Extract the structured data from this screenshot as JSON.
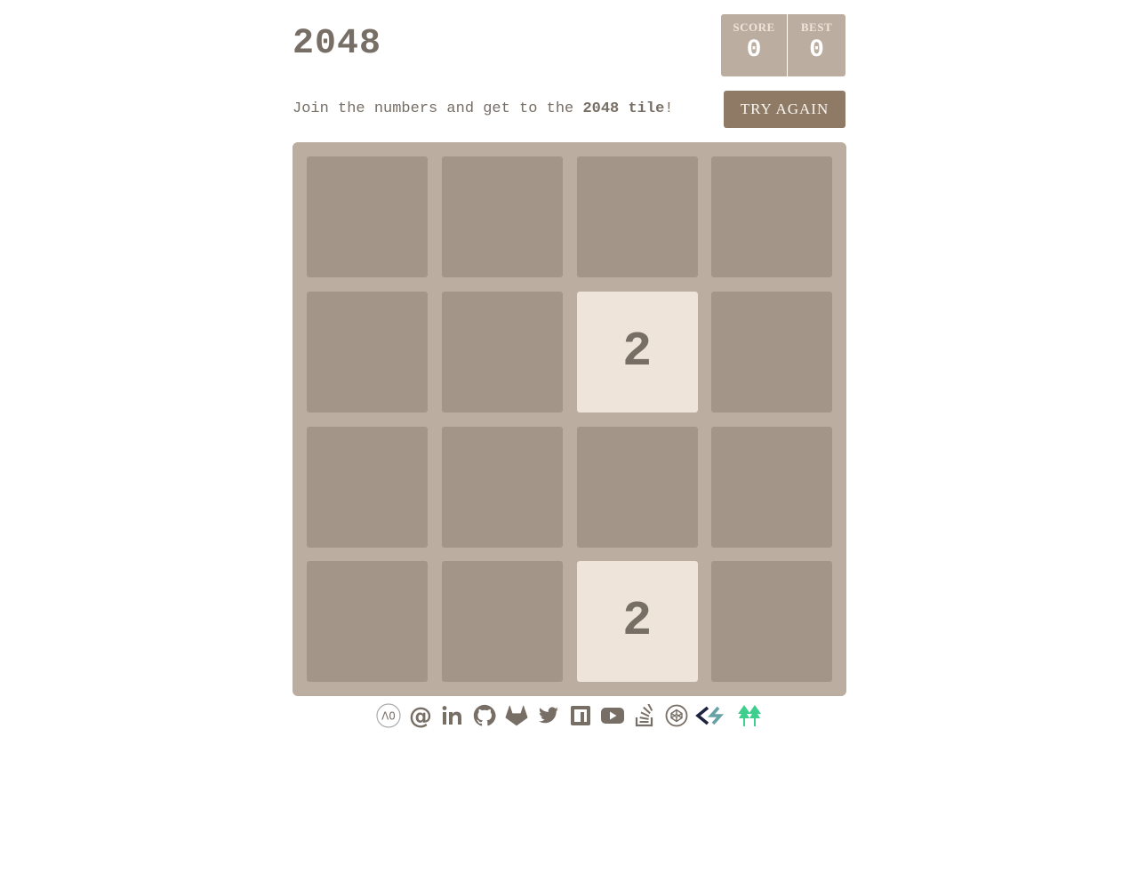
{
  "game": {
    "title": "2048",
    "score_label": "SCORE",
    "score_value": "0",
    "best_label": "BEST",
    "best_value": "0",
    "intro_prefix": "Join the numbers and get to the ",
    "intro_bold": "2048 tile",
    "intro_suffix": "!",
    "try_again_label": "TRY AGAIN"
  },
  "board": {
    "size": 4,
    "tiles": [
      {
        "row": 2,
        "col": 3,
        "value": "2"
      },
      {
        "row": 4,
        "col": 3,
        "value": "2"
      }
    ]
  },
  "colors": {
    "board_bg": "#bbada0",
    "cell_bg": "#a39689",
    "tile_2_bg": "#eee4da",
    "text": "#776e65",
    "button_bg": "#8f7a66"
  },
  "social_links": [
    {
      "icon": "a0-icon",
      "label": "A0"
    },
    {
      "icon": "email-at-icon",
      "label": "Email"
    },
    {
      "icon": "linkedin-icon",
      "label": "LinkedIn"
    },
    {
      "icon": "github-icon",
      "label": "GitHub"
    },
    {
      "icon": "gitlab-icon",
      "label": "GitLab"
    },
    {
      "icon": "twitter-icon",
      "label": "Twitter"
    },
    {
      "icon": "npm-icon",
      "label": "npm"
    },
    {
      "icon": "youtube-icon",
      "label": "YouTube"
    },
    {
      "icon": "stackoverflow-icon",
      "label": "Stack Overflow"
    },
    {
      "icon": "codepen-icon",
      "label": "CodePen"
    },
    {
      "icon": "codersrank-icon",
      "label": "CodersRank"
    },
    {
      "icon": "linktree-icon",
      "label": "Linktree"
    }
  ]
}
